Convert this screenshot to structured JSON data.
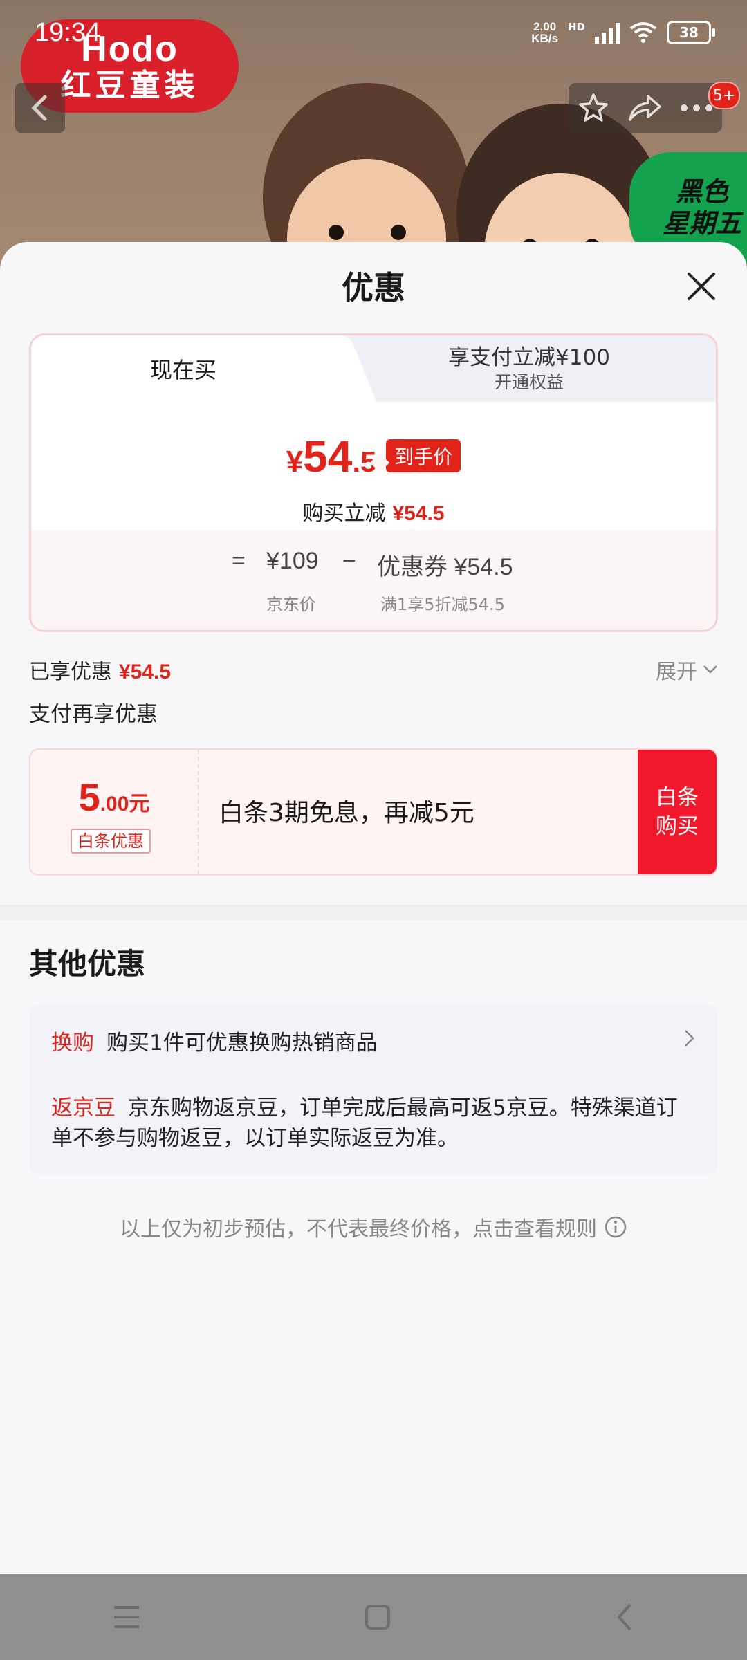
{
  "status_bar": {
    "time": "19:34",
    "net_speed_value": "2.00",
    "net_speed_unit": "KB/s",
    "hd_label": "HD",
    "battery": "38"
  },
  "product_banner": {
    "brand_logo_line1": "Hodo",
    "brand_logo_line2": "红豆童装",
    "promo_line1": "黑色",
    "promo_line2": "星期五",
    "notification_count": "5+"
  },
  "sheet": {
    "title": "优惠",
    "tabs": [
      {
        "label": "现在买"
      },
      {
        "label": "享支付立减¥100",
        "sublabel": "开通权益"
      }
    ],
    "price": {
      "yen": "¥",
      "integer": "54",
      "decimal": ".5",
      "tag": "到手价",
      "discount_label": "购买立减",
      "discount_amount": "¥54.5"
    },
    "formula": {
      "equals": "=",
      "base_price": "¥109",
      "base_label": "京东价",
      "minus": "−",
      "coupon": "优惠券 ¥54.5",
      "coupon_rule": "满1享5折减54.5"
    },
    "enjoyed_label": "已享优惠",
    "enjoyed_amount": "¥54.5",
    "expand_label": "展开",
    "pay_more_label": "支付再享优惠",
    "baitiao": {
      "amount_int": "5",
      "amount_dec": ".00元",
      "tag": "白条优惠",
      "description": "白条3期免息，再减5元",
      "buy_line1": "白条",
      "buy_line2": "购买"
    },
    "other_title": "其他优惠",
    "other_items": [
      {
        "tag": "换购",
        "text": "购买1件可优惠换购热销商品"
      },
      {
        "tag": "返京豆",
        "text": "京东购物返京豆，订单完成后最高可返5京豆。特殊渠道订单不参与购物返豆，以订单实际返豆为准。"
      }
    ],
    "disclaimer": "以上仅为初步预估，不代表最终价格，点击查看规则"
  },
  "colors": {
    "accent_red": "#e2231a",
    "brand_red": "#d9202a",
    "promo_green": "#13a34f"
  },
  "icons": [
    "back-icon",
    "star-icon",
    "share-icon",
    "more-icon",
    "close-icon",
    "chevron-down-icon",
    "chevron-right-icon",
    "info-icon",
    "menu-icon",
    "home-icon",
    "back-nav-icon"
  ]
}
